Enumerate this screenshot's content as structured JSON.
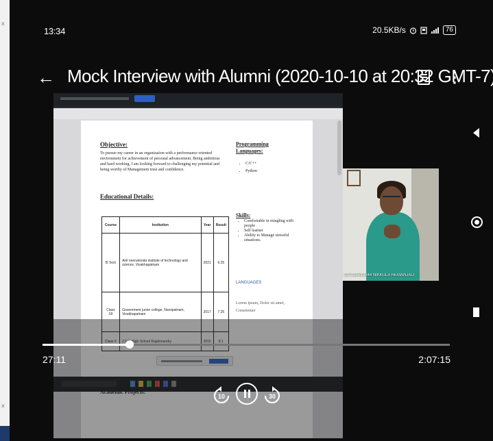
{
  "status_bar": {
    "time": "13:34",
    "indicators": "20.5KB/s",
    "battery": "76"
  },
  "header": {
    "title": "Mock Interview with Alumni (2020-10-10 at 20:32 GMT-7)"
  },
  "document": {
    "objective_heading": "Objective:",
    "objective_text": "To pursue my career in an organization with a performance oriented environment for achievement of personal advancement. Being ambitious and hard working, I am looking forward to challenging my potential and being worthy of Management trust and confidence.",
    "education_heading": "Educational Details:",
    "table_headers": [
      "Course",
      "Institution",
      "Year",
      "Result"
    ],
    "table_rows": [
      [
        "B.Tech",
        "Anil neerukonda institute of technology and science, Visakhapatnam",
        "2021",
        "6.25"
      ],
      [
        "Class XII",
        "Government junior college, Narsipatnam, Visakhapatnam",
        "2017",
        "7.25"
      ],
      [
        "Class X",
        "Z.P.P. High School Rajahmundry",
        "2015",
        "8.1"
      ]
    ],
    "programming_heading": "Programming Languages:",
    "programming_items": [
      "C/C++",
      "Python"
    ],
    "skills_heading": "Skills:",
    "skills_items": [
      "Comfortable in mingling with people",
      "Self learner",
      "Ability to Manage stressful situations."
    ],
    "languages_heading": "LANGUAGES",
    "lorem_text": "Lorem ipsum, Dolor sit amet, Consetetuer",
    "academic_heading": "Academic Projects:"
  },
  "webcam": {
    "participant_label": "317126512044 NIKKULA HEMANJALI"
  },
  "player": {
    "current_time": "27:11",
    "total_time": "2:07:15",
    "progress_fraction": 0.213,
    "rewind_label": "10",
    "forward_label": "30"
  },
  "colors": {
    "background": "#000000",
    "accent_blue": "#2d63c8",
    "cam_shirt": "#2a9a8a"
  }
}
